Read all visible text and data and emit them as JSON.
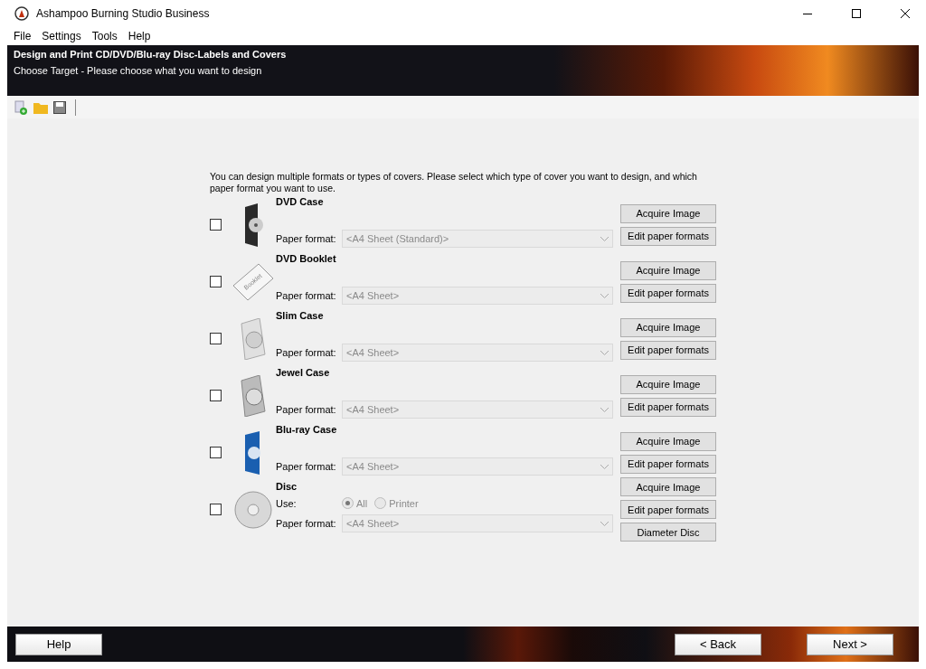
{
  "window": {
    "title": "Ashampoo Burning Studio Business"
  },
  "menu": [
    "File",
    "Settings",
    "Tools",
    "Help"
  ],
  "banner": {
    "title": "Design and Print CD/DVD/Blu-ray Disc-Labels and Covers",
    "subtitle": "Choose Target - Please choose what you want to design"
  },
  "intro": "You can design multiple formats or types of covers. Please select which type of cover you want to design, and which paper format you want to use.",
  "covers": [
    {
      "kind": "dvd-case",
      "title": "DVD Case",
      "checked": false,
      "format_label": "Paper format:",
      "format": "<A4 Sheet (Standard)>",
      "buttons": [
        "Acquire Image",
        "Edit paper formats"
      ]
    },
    {
      "kind": "booklet",
      "title": "DVD Booklet",
      "checked": false,
      "format_label": "Paper format:",
      "format": "<A4 Sheet>",
      "booklet_text": "Booklet",
      "buttons": [
        "Acquire Image",
        "Edit paper formats"
      ]
    },
    {
      "kind": "slim-case",
      "title": "Slim Case",
      "checked": false,
      "format_label": "Paper format:",
      "format": "<A4 Sheet>",
      "buttons": [
        "Acquire Image",
        "Edit paper formats"
      ]
    },
    {
      "kind": "jewel-case",
      "title": "Jewel Case",
      "checked": false,
      "format_label": "Paper format:",
      "format": "<A4 Sheet>",
      "buttons": [
        "Acquire Image",
        "Edit paper formats"
      ]
    },
    {
      "kind": "bluray-case",
      "title": "Blu-ray Case",
      "checked": false,
      "format_label": "Paper format:",
      "format": "<A4 Sheet>",
      "buttons": [
        "Acquire Image",
        "Edit paper formats"
      ]
    },
    {
      "kind": "disc",
      "title": "Disc",
      "checked": false,
      "use_label": "Use:",
      "use_options": [
        {
          "label": "All",
          "selected": true
        },
        {
          "label": "Printer",
          "selected": false
        }
      ],
      "format_label": "Paper format:",
      "format": "<A4 Sheet>",
      "buttons": [
        "Acquire Image",
        "Edit paper formats",
        "Diameter Disc"
      ]
    }
  ],
  "footer": {
    "help": "Help",
    "back": "< Back",
    "next": "Next >"
  }
}
